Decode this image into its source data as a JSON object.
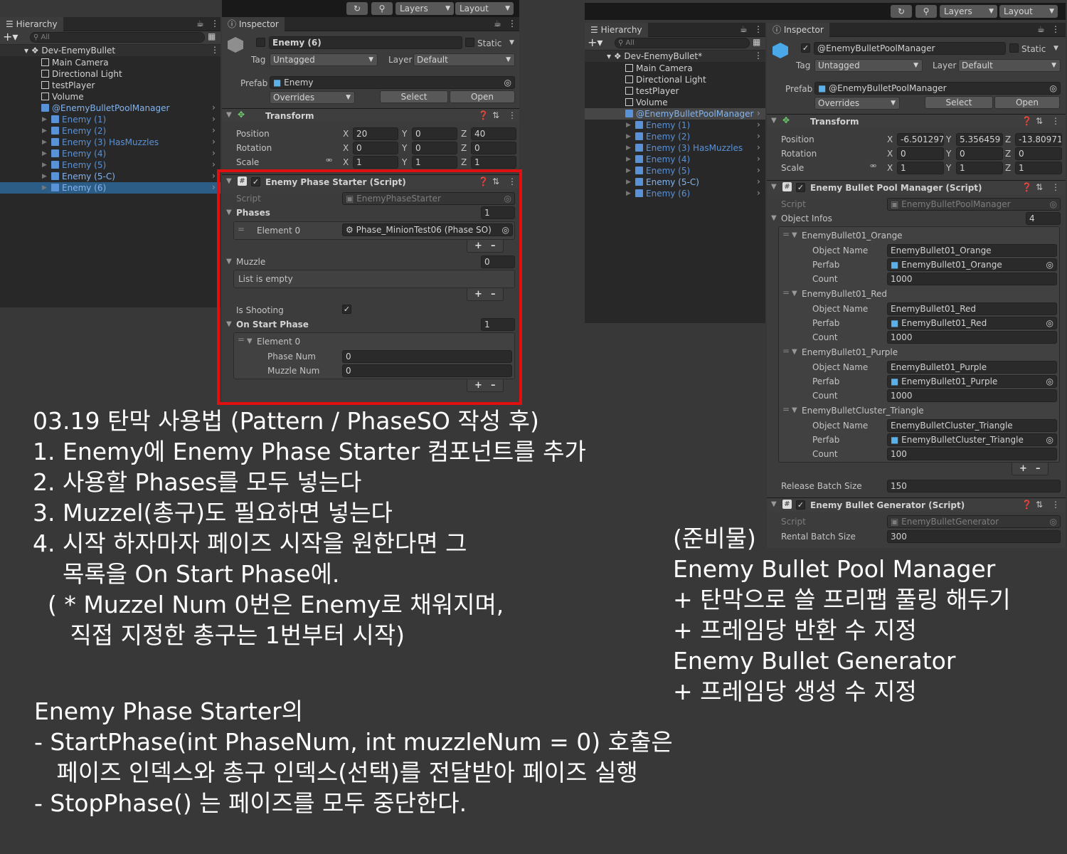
{
  "left": {
    "toolbar": {
      "layers": "Layers",
      "layout": "Layout"
    },
    "hierarchy": {
      "tab": "Hierarchy",
      "search_placeholder": "All",
      "scene": "Dev-EnemyBullet",
      "items": [
        {
          "label": "Main Camera"
        },
        {
          "label": "Directional Light"
        },
        {
          "label": "testPlayer"
        },
        {
          "label": "Volume"
        },
        {
          "label": "@EnemyBulletPoolManager"
        },
        {
          "label": "Enemy (1)"
        },
        {
          "label": "Enemy (2)"
        },
        {
          "label": "Enemy (3) HasMuzzles"
        },
        {
          "label": "Enemy (4)"
        },
        {
          "label": "Enemy (5)"
        },
        {
          "label": "Enemy (5-C)"
        },
        {
          "label": "Enemy (6)"
        }
      ]
    },
    "inspector": {
      "tab": "Inspector",
      "object_name": "Enemy (6)",
      "static_label": "Static",
      "tag_label": "Tag",
      "tag_value": "Untagged",
      "layer_label": "Layer",
      "layer_value": "Default",
      "prefab_label": "Prefab",
      "prefab_value": "Enemy",
      "overrides": "Overrides",
      "select": "Select",
      "open": "Open",
      "transform": {
        "title": "Transform",
        "position_label": "Position",
        "rotation_label": "Rotation",
        "scale_label": "Scale",
        "position": {
          "x": "20",
          "y": "0",
          "z": "40"
        },
        "rotation": {
          "x": "0",
          "y": "0",
          "z": "0"
        },
        "scale": {
          "x": "1",
          "y": "1",
          "z": "1"
        }
      },
      "phase_starter": {
        "title": "Enemy Phase Starter (Script)",
        "script_label": "Script",
        "script_value": "EnemyPhaseStarter",
        "phases_label": "Phases",
        "phases_count": "1",
        "element0_label": "Element 0",
        "element0_value": "Phase_MinionTest06 (Phase SO)",
        "muzzle_label": "Muzzle",
        "muzzle_count": "0",
        "list_empty": "List is empty",
        "is_shooting_label": "Is Shooting",
        "on_start_label": "On Start Phase",
        "on_start_count": "1",
        "on_start_element": "Element 0",
        "phase_num_label": "Phase Num",
        "phase_num": "0",
        "muzzle_num_label": "Muzzle Num",
        "muzzle_num": "0"
      }
    }
  },
  "right": {
    "toolbar": {
      "layers": "Layers",
      "layout": "Layout"
    },
    "hierarchy": {
      "tab": "Hierarchy",
      "search_placeholder": "All",
      "scene": "Dev-EnemyBullet*",
      "items": [
        {
          "label": "Main Camera"
        },
        {
          "label": "Directional Light"
        },
        {
          "label": "testPlayer"
        },
        {
          "label": "Volume"
        },
        {
          "label": "@EnemyBulletPoolManager"
        },
        {
          "label": "Enemy (1)"
        },
        {
          "label": "Enemy (2)"
        },
        {
          "label": "Enemy (3) HasMuzzles"
        },
        {
          "label": "Enemy (4)"
        },
        {
          "label": "Enemy (5)"
        },
        {
          "label": "Enemy (5-C)"
        },
        {
          "label": "Enemy (6)"
        }
      ]
    },
    "inspector": {
      "tab": "Inspector",
      "object_name": "@EnemyBulletPoolManager",
      "static_label": "Static",
      "tag_label": "Tag",
      "tag_value": "Untagged",
      "layer_label": "Layer",
      "layer_value": "Default",
      "prefab_label": "Prefab",
      "prefab_value": "@EnemyBulletPoolManager",
      "overrides": "Overrides",
      "select": "Select",
      "open": "Open",
      "transform": {
        "title": "Transform",
        "position_label": "Position",
        "rotation_label": "Rotation",
        "scale_label": "Scale",
        "position": {
          "x": "-6.501297",
          "y": "5.356459",
          "z": "-13.80971"
        },
        "rotation": {
          "x": "0",
          "y": "0",
          "z": "0"
        },
        "scale": {
          "x": "1",
          "y": "1",
          "z": "1"
        }
      },
      "pool_manager": {
        "title": "Enemy Bullet Pool Manager (Script)",
        "script_label": "Script",
        "script_value": "EnemyBulletPoolManager",
        "object_infos_label": "Object Infos",
        "object_infos_count": "4",
        "object_name_label": "Object Name",
        "perfab_label": "Perfab",
        "count_label": "Count",
        "entries": [
          {
            "header": "EnemyBullet01_Orange",
            "name": "EnemyBullet01_Orange",
            "perfab": "EnemyBullet01_Orange",
            "count": "1000"
          },
          {
            "header": "EnemyBullet01_Red",
            "name": "EnemyBullet01_Red",
            "perfab": "EnemyBullet01_Red",
            "count": "1000"
          },
          {
            "header": "EnemyBullet01_Purple",
            "name": "EnemyBullet01_Purple",
            "perfab": "EnemyBullet01_Purple",
            "count": "1000"
          },
          {
            "header": "EnemyBulletCluster_Triangle",
            "name": "EnemyBulletCluster_Triangle",
            "perfab": "EnemyBulletCluster_Triangle",
            "count": "100"
          }
        ],
        "release_label": "Release Batch Size",
        "release_value": "150"
      },
      "generator": {
        "title": "Enemy Bullet Generator (Script)",
        "script_label": "Script",
        "script_value": "EnemyBulletGenerator",
        "rental_label": "Rental Batch Size",
        "rental_value": "300"
      }
    }
  },
  "notes": {
    "left": [
      "03.19 탄막 사용법 (Pattern / PhaseSO 작성 후)",
      "1. Enemy에 Enemy Phase Starter 컴포넌트를 추가",
      "2. 사용할 Phases를 모두 넣는다",
      "3. Muzzel(총구)도 필요하면 넣는다",
      "4. 시작 하자마자 페이즈 시작을 원한다면 그",
      "    목록을 On Start Phase에.",
      "  ( * Muzzel Num 0번은 Enemy로 채워지며,",
      "     직접 지정한 총구는 1번부터 시작)"
    ],
    "bottom": [
      "Enemy Phase Starter의",
      "- StartPhase(int PhaseNum, int muzzleNum = 0) 호출은",
      "   페이즈 인덱스와 총구 인덱스(선택)를 전달받아 페이즈 실행",
      "- StopPhase() 는 페이즈를 모두 중단한다."
    ],
    "right": [
      "(준비물)",
      "Enemy Bullet Pool Manager",
      "+ 탄막으로 쓸 프리팹 풀링 해두기",
      "+ 프레임당 반환 수 지정",
      "Enemy Bullet Generator",
      "+ 프레임당 생성 수 지정"
    ]
  },
  "colors": {
    "highlight_box": "#e01010",
    "selection": "#2c5d87",
    "blue_text": "#5a92d8"
  }
}
